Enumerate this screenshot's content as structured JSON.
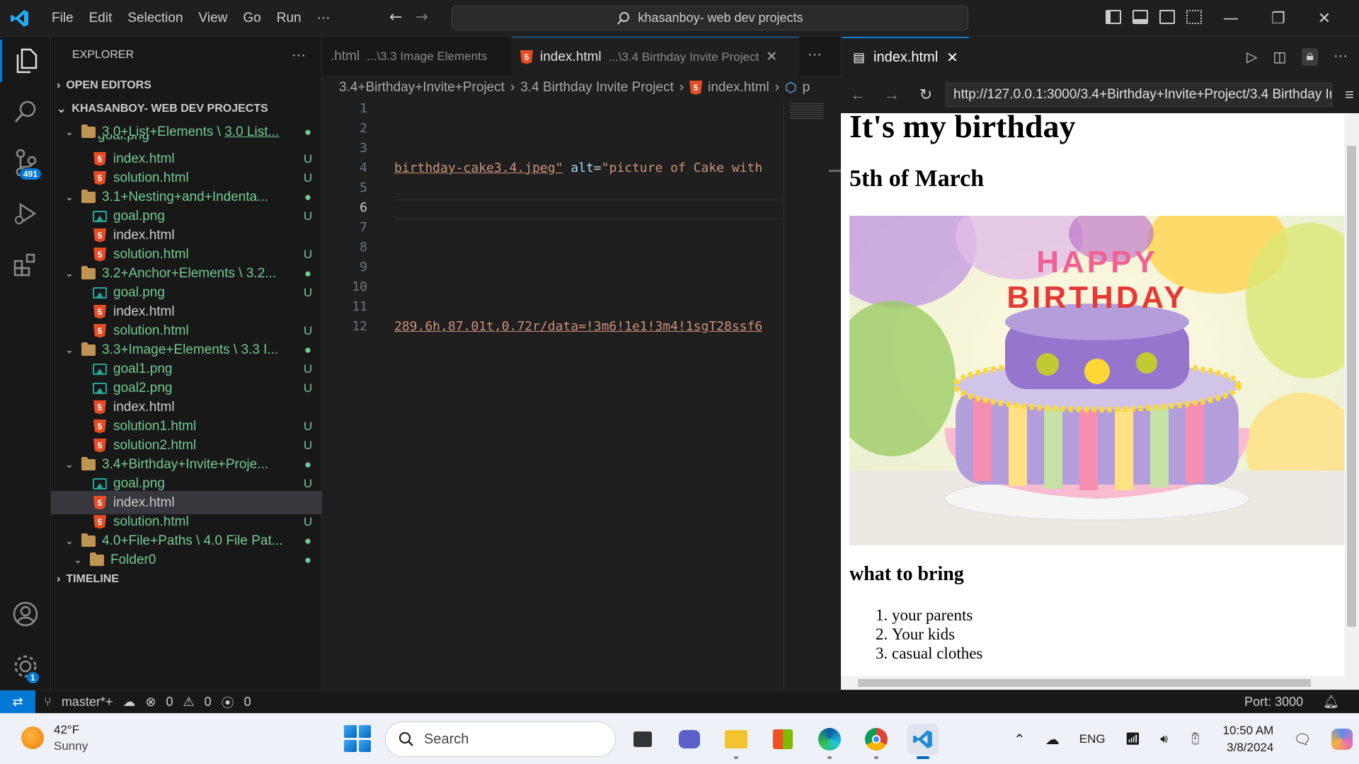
{
  "titlebar": {
    "menus": [
      "File",
      "Edit",
      "Selection",
      "View",
      "Go",
      "Run"
    ],
    "more": "···",
    "search_text": "khasanboy- web dev projects"
  },
  "activity": {
    "scm_badge": "491",
    "settings_badge": "1"
  },
  "explorer": {
    "title": "EXPLORER",
    "more": "···",
    "open_editors": "OPEN EDITORS",
    "project": "KHASANBOY- WEB DEV PROJECTS",
    "timeline": "TIMELINE",
    "rows": [
      {
        "name": "3.0+List+Elements",
        "suffix": "3.0 List...",
        "status": "●"
      },
      {
        "name": "goal.png",
        "status": ""
      },
      {
        "name": "index.html",
        "status": "U"
      },
      {
        "name": "solution.html",
        "status": "U"
      },
      {
        "name": "3.1+Nesting+and+Indenta...",
        "status": "●"
      },
      {
        "name": "goal.png",
        "status": "U"
      },
      {
        "name": "index.html",
        "status": ""
      },
      {
        "name": "solution.html",
        "status": "U"
      },
      {
        "name": "3.2+Anchor+Elements",
        "suffix": "3.2...",
        "status": "●"
      },
      {
        "name": "goal.png",
        "status": "U"
      },
      {
        "name": "index.html",
        "status": ""
      },
      {
        "name": "solution.html",
        "status": "U"
      },
      {
        "name": "3.3+Image+Elements",
        "suffix": "3.3 I...",
        "status": "●"
      },
      {
        "name": "goal1.png",
        "status": "U"
      },
      {
        "name": "goal2.png",
        "status": "U"
      },
      {
        "name": "index.html",
        "status": ""
      },
      {
        "name": "solution1.html",
        "status": "U"
      },
      {
        "name": "solution2.html",
        "status": "U"
      },
      {
        "name": "3.4+Birthday+Invite+Proje...",
        "status": "●"
      },
      {
        "name": "goal.png",
        "status": "U"
      },
      {
        "name": "index.html",
        "status": ""
      },
      {
        "name": "solution.html",
        "status": "U"
      },
      {
        "name": "4.0+File+Paths",
        "suffix": "4.0 File Pat...",
        "status": "●"
      },
      {
        "name": "Folder0",
        "status": "●"
      }
    ]
  },
  "editor": {
    "tabs": [
      {
        "name": ".html",
        "desc": "...\\3.3 Image Elements"
      },
      {
        "name": "index.html",
        "desc": "...\\3.4 Birthday Invite Project"
      }
    ],
    "more": "···",
    "breadcrumb": [
      "3.4+Birthday+Invite+Project",
      "3.4 Birthday Invite Project",
      "index.html",
      "p"
    ],
    "line_numbers": [
      "1",
      "2",
      "3",
      "4",
      "5",
      "6",
      "7",
      "8",
      "9",
      "10",
      "11",
      "12"
    ],
    "line4": {
      "value": "birthday-cake3.4.jpeg\"",
      "attr": "alt",
      "eq": "=",
      "alt_value": "\"picture of Cake with"
    },
    "line12": "289.6h,87.01t,0.72r/data=!3m6!1e1!3m4!1sgT28ssf6"
  },
  "preview": {
    "tab": "index.html",
    "url": "http://127.0.0.1:3000/3.4+Birthday+Invite+Project/3.4 Birthday Invite Project/index.html",
    "h1": "It's my birthday",
    "h2": "5th of March",
    "h3": "what to bring",
    "items": [
      "your parents",
      "Your kids",
      "casual clothes"
    ],
    "cake_text": "HAPPY BIRTHDAY"
  },
  "statusbar": {
    "branch": "master*+",
    "errors": "0",
    "warnings": "0",
    "ports": "0",
    "port": "Port: 3000"
  },
  "taskbar": {
    "temp": "42°F",
    "condition": "Sunny",
    "search": "Search",
    "lang": "ENG",
    "time": "10:50 AM",
    "date": "3/8/2024"
  },
  "colors": {
    "accent": "#0078d4",
    "untracked": "#73c991",
    "html_icon": "#e44d26",
    "image_icon": "#26a69a"
  }
}
